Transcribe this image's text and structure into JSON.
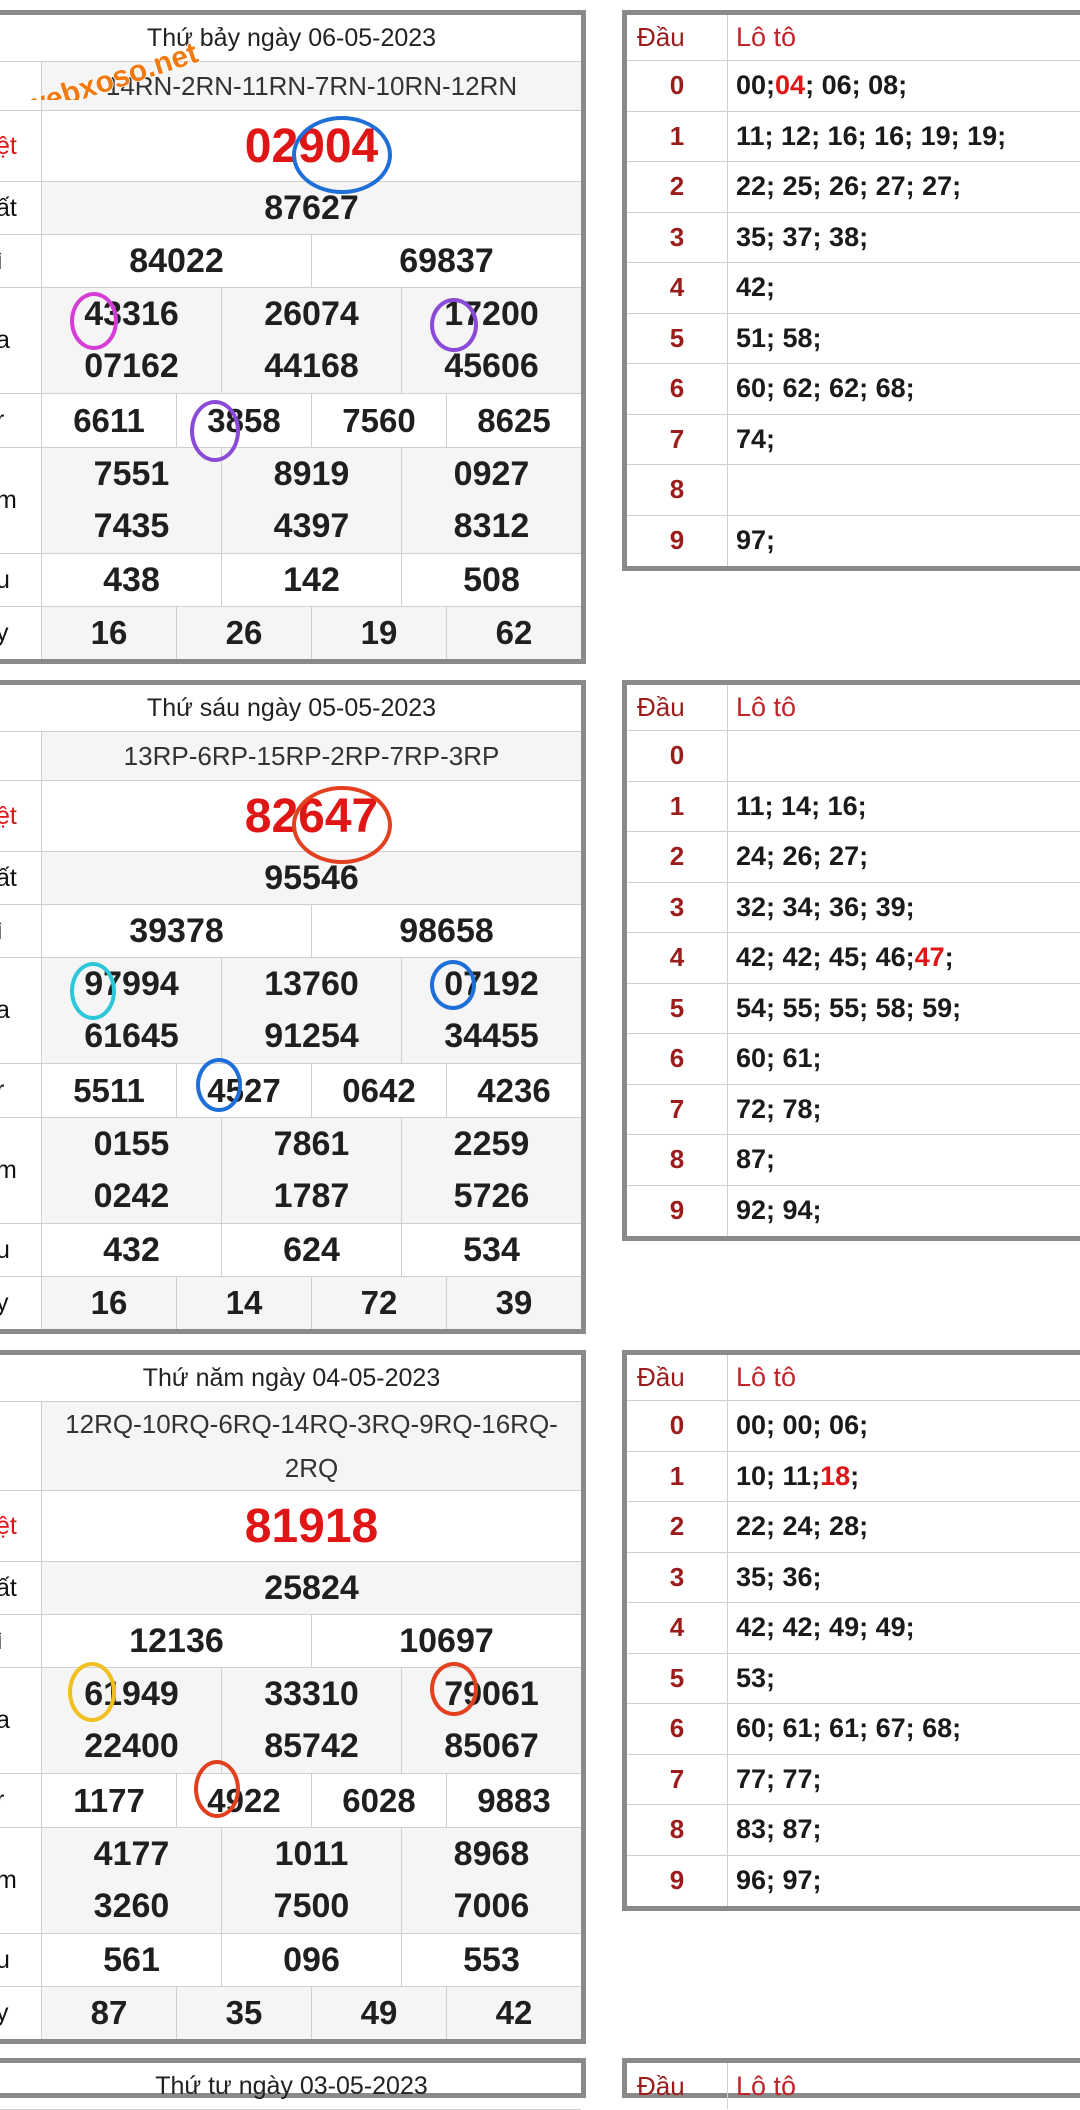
{
  "watermark": "webxoso.net",
  "blocks": [
    {
      "title": "Thứ bảy ngày 06-05-2023",
      "code": "14RN-2RN-11RN-7RN-10RN-12RN",
      "labels": {
        "db": "ệt",
        "g1": "ất",
        "g2": "ì",
        "g3": "a",
        "g4": "r",
        "g5": "m",
        "g6": "u",
        "g7": "y"
      },
      "db": "02904",
      "g1": "87627",
      "g2": [
        "84022",
        "69837"
      ],
      "g3": [
        "43316",
        "26074",
        "17200",
        "07162",
        "44168",
        "45606"
      ],
      "g4": [
        "6611",
        "3858",
        "7560",
        "8625"
      ],
      "g5": [
        "7551",
        "8919",
        "0927",
        "7435",
        "4397",
        "8312"
      ],
      "g6": [
        "438",
        "142",
        "508"
      ],
      "g7": [
        "16",
        "26",
        "19",
        "62"
      ],
      "loto_header": [
        "Đầu",
        "Lô tô"
      ],
      "loto": [
        "00; 04; 06; 08;",
        "11; 12; 16; 16; 19; 19;",
        "22; 25; 26; 27; 27;",
        "35; 37; 38;",
        "42;",
        "51; 58;",
        "60; 62; 62; 68;",
        "74;",
        "",
        "97;"
      ],
      "loto_highlight": {
        "row": 0,
        "text": "04"
      }
    },
    {
      "title": "Thứ sáu ngày 05-05-2023",
      "code": "13RP-6RP-15RP-2RP-7RP-3RP",
      "labels": {
        "db": "ệt",
        "g1": "ất",
        "g2": "ì",
        "g3": "a",
        "g4": "r",
        "g5": "m",
        "g6": "u",
        "g7": "y"
      },
      "db": "82647",
      "g1": "95546",
      "g2": [
        "39378",
        "98658"
      ],
      "g3": [
        "97994",
        "13760",
        "07192",
        "61645",
        "91254",
        "34455"
      ],
      "g4": [
        "5511",
        "4527",
        "0642",
        "4236"
      ],
      "g5": [
        "0155",
        "7861",
        "2259",
        "0242",
        "1787",
        "5726"
      ],
      "g6": [
        "432",
        "624",
        "534"
      ],
      "g7": [
        "16",
        "14",
        "72",
        "39"
      ],
      "loto_header": [
        "Đầu",
        "Lô tô"
      ],
      "loto": [
        "",
        "11; 14; 16;",
        "24; 26; 27;",
        "32; 34; 36; 39;",
        "42; 42; 45; 46; 47;",
        "54; 55; 55; 58; 59;",
        "60; 61;",
        "72; 78;",
        "87;",
        "92; 94;"
      ],
      "loto_highlight": {
        "row": 4,
        "text": "47"
      }
    },
    {
      "title": "Thứ năm ngày 04-05-2023",
      "code": "12RQ-10RQ-6RQ-14RQ-3RQ-9RQ-16RQ-2RQ",
      "labels": {
        "db": "ệt",
        "g1": "ất",
        "g2": "ì",
        "g3": "a",
        "g4": "r",
        "g5": "m",
        "g6": "u",
        "g7": "y"
      },
      "db": "81918",
      "g1": "25824",
      "g2": [
        "12136",
        "10697"
      ],
      "g3": [
        "61949",
        "33310",
        "79061",
        "22400",
        "85742",
        "85067"
      ],
      "g4": [
        "1177",
        "4922",
        "6028",
        "9883"
      ],
      "g5": [
        "4177",
        "1011",
        "8968",
        "3260",
        "7500",
        "7006"
      ],
      "g6": [
        "561",
        "096",
        "553"
      ],
      "g7": [
        "87",
        "35",
        "49",
        "42"
      ],
      "loto_header": [
        "Đầu",
        "Lô tô"
      ],
      "loto": [
        "00; 00; 06;",
        "10; 11; 18;",
        "22; 24; 28;",
        "35; 36;",
        "42; 42; 49; 49;",
        "53;",
        "60; 61; 61; 67; 68;",
        "77; 77;",
        "83; 87;",
        "96; 97;"
      ],
      "loto_highlight": {
        "row": 1,
        "text": "18"
      }
    }
  ],
  "partial": {
    "title": "Thứ tư ngày 03-05-2023",
    "loto_header": [
      "Đầu",
      "Lô tô"
    ]
  },
  "colors": {
    "accent_red": "#e01515",
    "dau_red": "#9b1c1c",
    "circle_blue": "#1f6fd9",
    "circle_purple": "#8a4bd6",
    "circle_magenta": "#d63cd6",
    "circle_cyan": "#2cc7d8",
    "circle_orange": "#e2401f",
    "circle_yellow": "#f0c020"
  }
}
